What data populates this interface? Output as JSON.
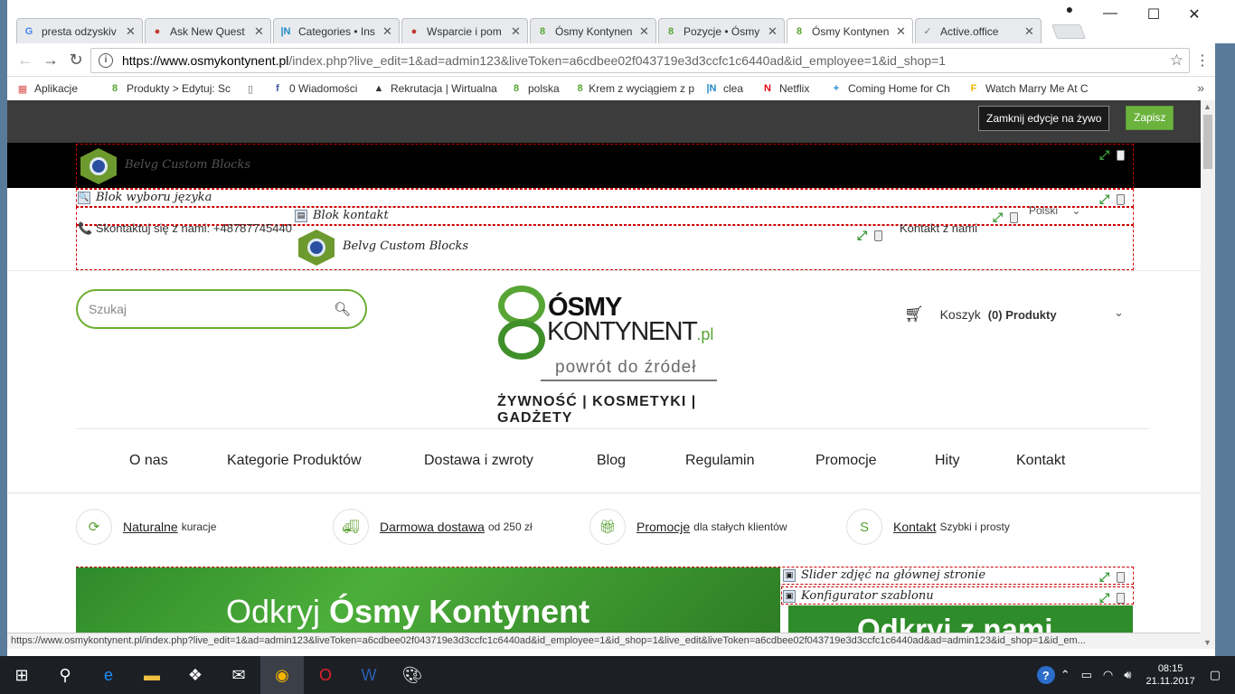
{
  "browser": {
    "tabs": [
      {
        "title": "presta odzyskiv",
        "icon": "G",
        "icon_color": "#4285f4",
        "active": false
      },
      {
        "title": "Ask New Quest",
        "icon": "●",
        "icon_color": "#c0392b",
        "active": false
      },
      {
        "title": "Categories • Ins",
        "icon": "|N",
        "icon_color": "#1e88c8",
        "active": false
      },
      {
        "title": "Wsparcie i pom",
        "icon": "●",
        "icon_color": "#c0392b",
        "active": false
      },
      {
        "title": "Ósmy Kontynen",
        "icon": "8",
        "icon_color": "#57a534",
        "active": false
      },
      {
        "title": "Pozycje • Ósmy",
        "icon": "8",
        "icon_color": "#57a534",
        "active": false
      },
      {
        "title": "Ósmy Kontynen",
        "icon": "8",
        "icon_color": "#57a534",
        "active": true
      },
      {
        "title": "Active.office",
        "icon": "✓",
        "icon_color": "#7a7a7a",
        "active": false
      }
    ],
    "tab_close": "✕",
    "url_host": "https://www.osmykontynent.pl",
    "url_rest": "/index.php?live_edit=1&ad=admin123&liveToken=a6cdbee02f043719e3d3ccfc1c6440ad&id_employee=1&id_shop=1",
    "bookmarks": [
      {
        "label": "Aplikacje",
        "icon": "▦",
        "icon_color": "#d9534f"
      },
      {
        "label": "Produkty > Edytuj: Sc",
        "icon": "8",
        "icon_color": "#57a534"
      },
      {
        "label": "",
        "icon": "▯",
        "icon_color": "#666"
      },
      {
        "label": "0 Wiadomości",
        "icon": "f",
        "icon_color": "#3b5998"
      },
      {
        "label": "Rekrutacja | Wirtualna",
        "icon": "▲",
        "icon_color": "#333"
      },
      {
        "label": "polska",
        "icon": "8",
        "icon_color": "#57a534"
      },
      {
        "label": "Krem z wyciągiem z p",
        "icon": "8",
        "icon_color": "#57a534"
      },
      {
        "label": "clea",
        "icon": "|N",
        "icon_color": "#1e88c8"
      },
      {
        "label": "Netflix",
        "icon": "N",
        "icon_color": "#e50914"
      },
      {
        "label": "Coming Home for Ch",
        "icon": "+",
        "icon_color": "#1e88c8"
      },
      {
        "label": "Watch Marry Me At C",
        "icon": "F",
        "icon_color": "#f0b400"
      }
    ],
    "status_url": "https://www.osmykontynent.pl/index.php?live_edit=1&ad=admin123&liveToken=a6cdbee02f043719e3d3ccfc1c6440ad&id_employee=1&id_shop=1&live_edit&liveToken=a6cdbee02f043719e3d3ccfc1c6440ad&ad=admin123&id_shop=1&id_em..."
  },
  "live_edit": {
    "close_label": "Zamknij edycje na żywo",
    "save_label": "Zapisz"
  },
  "modules": {
    "belvg_top": "Belvg Custom Blocks",
    "lang_block": "Blok wyboru języka",
    "contact_block": "Blok kontakt",
    "belvg_second": "Belvg Custom Blocks",
    "slider_module": "Slider zdjęć na głównej stronie",
    "theme_configurator": "Konfigurator szablonu"
  },
  "header": {
    "phone": "Skontaktuj się z nami: +48787745440",
    "contact_link": "Kontakt z nami",
    "language": "Polski",
    "search_placeholder": "Szukaj",
    "cart_label": "Koszyk",
    "cart_count": "(0) Produkty"
  },
  "logo": {
    "name_line1": "ÓSMY",
    "name_line2": "KONTYNENT",
    "domain": ".pl",
    "tagline": "powrót do źródeł",
    "categories": "ŻYWNOŚĆ | KOSMETYKI | GADŻETY"
  },
  "menu": [
    "O nas",
    "Kategorie Produktów",
    "Dostawa i zwroty",
    "Blog",
    "Regulamin",
    "Promocje",
    "Hity",
    "Kontakt"
  ],
  "features": [
    {
      "link": "Naturalne",
      "text": "kuracje",
      "icon": "refresh-icon"
    },
    {
      "link": "Darmowa dostawa",
      "text": "od 250 zł",
      "icon": "truck-icon"
    },
    {
      "link": "Promocje",
      "text": "dla stałych klientów",
      "icon": "gift-icon"
    },
    {
      "link": "Kontakt",
      "text": "Szybki i prosty",
      "icon": "skype-icon"
    }
  ],
  "slider": {
    "title_prefix": "Odkryj",
    "title_bold": "Ósmy Kontynent",
    "side_title": "Odkryj z nami"
  },
  "taskbar": {
    "time": "08:15",
    "date": "21.11.2017"
  },
  "colors": {
    "brand_green": "#57a534",
    "save_green": "#6cb33e",
    "livebar": "#3c3c3c"
  }
}
